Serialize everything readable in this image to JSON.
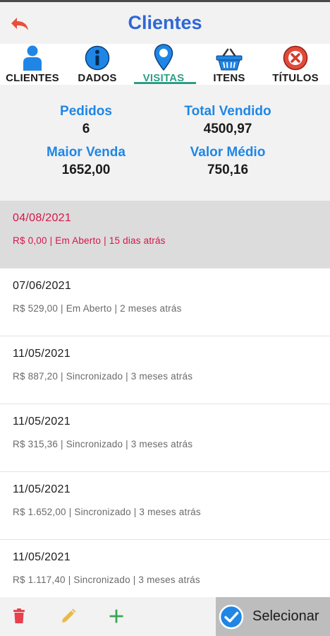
{
  "header": {
    "title": "Clientes",
    "back_icon": "back-arrow-icon"
  },
  "tabs": [
    {
      "label": "CLIENTES",
      "icon": "person-icon"
    },
    {
      "label": "DADOS",
      "icon": "info-icon"
    },
    {
      "label": "VISITAS",
      "icon": "map-pin-icon",
      "active": true
    },
    {
      "label": "ITENS",
      "icon": "basket-icon"
    },
    {
      "label": "TÍTULOS",
      "icon": "close-circle-icon"
    }
  ],
  "stats": {
    "pedidos": {
      "label": "Pedidos",
      "value": "6"
    },
    "total_vendido": {
      "label": "Total Vendido",
      "value": "4500,97"
    },
    "maior_venda": {
      "label": "Maior Venda",
      "value": "1652,00"
    },
    "valor_medio": {
      "label": "Valor Médio",
      "value": "750,16"
    }
  },
  "orders": [
    {
      "date": "04/08/2021",
      "info": "R$ 0,00  |  Em Aberto  |  15 dias atrás",
      "selected": true
    },
    {
      "date": "07/06/2021",
      "info": "R$ 529,00  |  Em Aberto  |  2 meses atrás"
    },
    {
      "date": "11/05/2021",
      "info": "R$ 887,20  |  Sincronizado  |  3 meses atrás"
    },
    {
      "date": "11/05/2021",
      "info": "R$ 315,36  |  Sincronizado  |  3 meses atrás"
    },
    {
      "date": "11/05/2021",
      "info": "R$ 1.652,00  |  Sincronizado  |  3 meses atrás"
    },
    {
      "date": "11/05/2021",
      "info": "R$ 1.117,40  |  Sincronizado  |  3 meses atrás"
    }
  ],
  "bottom_bar": {
    "delete_icon": "trash-icon",
    "edit_icon": "pencil-icon",
    "add_icon": "plus-icon",
    "select_label": "Selecionar",
    "select_icon": "check-circle-icon"
  },
  "colors": {
    "title": "#2f67d6",
    "stat_label": "#1f86e6",
    "active_tab": "#2e9e86",
    "selected_row_text": "#d6154a",
    "delete": "#e8404c",
    "edit": "#e8b94a",
    "add": "#3aa655"
  }
}
